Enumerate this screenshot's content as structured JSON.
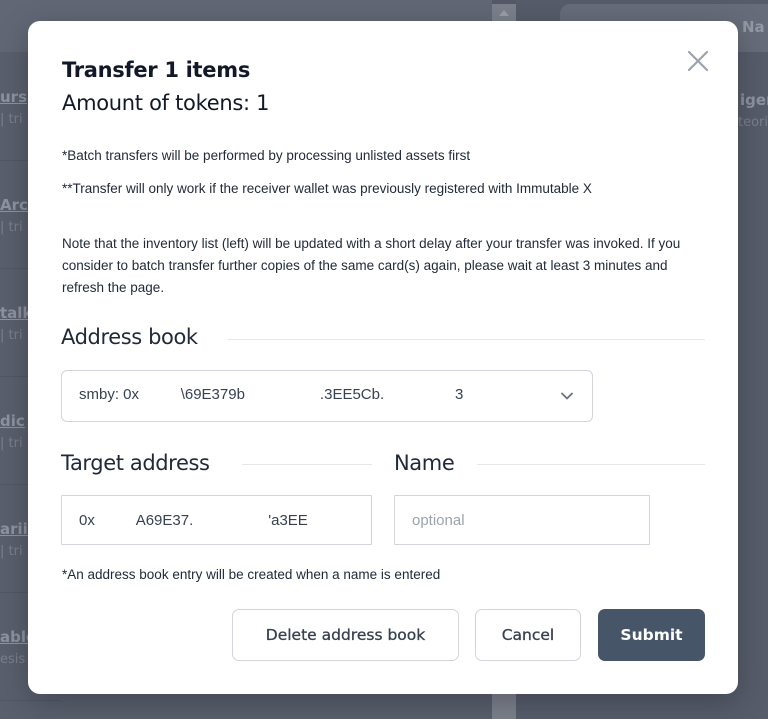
{
  "background": {
    "list_items": [
      {
        "title": "urs",
        "subtitle": "| tri"
      },
      {
        "title": "Arc",
        "subtitle": "| tri"
      },
      {
        "title": "talk",
        "subtitle": "| tri"
      },
      {
        "title": "dic",
        "subtitle": "| tri"
      },
      {
        "title": "arii",
        "subtitle": "| tri"
      },
      {
        "title": "able",
        "subtitle": "esis"
      }
    ],
    "right_header_label": "Na",
    "right_item_title": "iger",
    "right_item_subtitle": "teori"
  },
  "modal": {
    "title": "Transfer 1 items",
    "subtitle": "Amount of tokens: 1",
    "notes": [
      "*Batch transfers will be performed by processing unlisted assets first",
      "**Transfer will only work if the receiver wallet was previously registered with Immutable X",
      "Note that the inventory list (left) will be updated with a short delay after your transfer was invoked. If you consider to batch transfer further copies of the same card(s) again, please wait at least 3 minutes and refresh the page."
    ],
    "address_book": {
      "label": "Address book",
      "selected_value": "smby: 0x          \\69E379b                  .3EE5Cb.                 3"
    },
    "target_address": {
      "label": "Target address",
      "value": "0x          A69E37.                  'a3EE"
    },
    "name": {
      "label": "Name",
      "value": "",
      "placeholder": "optional"
    },
    "hint": "*An address book entry will be created when a name is entered",
    "buttons": {
      "delete": "Delete address book",
      "cancel": "Cancel",
      "submit": "Submit"
    },
    "icons": {
      "close": "close-icon",
      "chevron": "chevron-down-icon"
    },
    "colors": {
      "primary": "#475569",
      "border": "#d1d5db",
      "text": "#111827"
    }
  }
}
